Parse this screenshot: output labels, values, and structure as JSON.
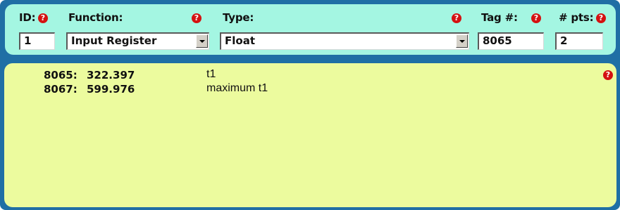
{
  "header": {
    "id_label": "ID:",
    "function_label": "Function:",
    "type_label": "Type:",
    "tag_label": "Tag #:",
    "pts_label": "# pts:",
    "help_glyph": "?"
  },
  "fields": {
    "id_value": "1",
    "function_value": "Input Register",
    "type_value": "Float",
    "tag_value": "8065",
    "pts_value": "2"
  },
  "readings": [
    {
      "address": "8065:",
      "value": "322.397",
      "description": "t1"
    },
    {
      "address": "8067:",
      "value": "599.976",
      "description": "maximum t1"
    }
  ],
  "colors": {
    "frame": "#1f6fa5",
    "header_panel": "#a4f6e2",
    "body_panel": "#ecfb9e",
    "help_icon": "#d41111"
  }
}
